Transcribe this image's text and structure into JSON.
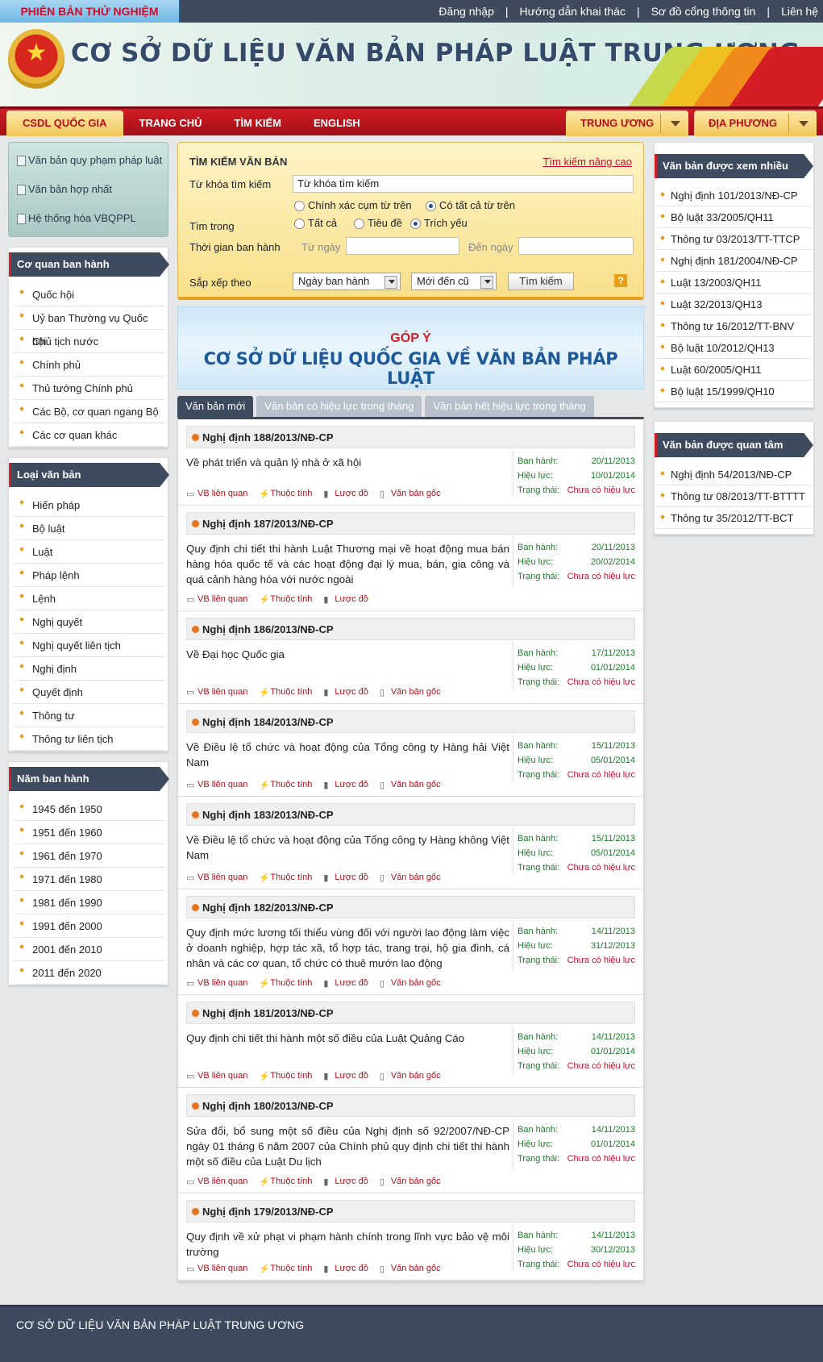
{
  "topbar": {
    "beta_label": "PHIÊN BẢN THỬ NGHIỆM",
    "links": [
      "Đăng nhập",
      "Hướng dẫn khai thác",
      "Sơ đồ cổng thông tin",
      "Liên hệ"
    ],
    "separator": "|"
  },
  "banner": {
    "title": "CƠ SỞ DỮ LIỆU VĂN BẢN PHÁP LUẬT TRUNG ƯƠNG"
  },
  "nav": {
    "left": [
      "CSDL QUỐC GIA",
      "TRANG CHỦ",
      "TÌM KIẾM",
      "ENGLISH"
    ],
    "right": [
      "TRUNG ƯƠNG",
      "ĐỊA PHƯƠNG"
    ]
  },
  "quick_links": [
    "Văn bản quy phạm pháp luật",
    "Văn bản hợp nhất",
    "Hệ thống hóa VBQPPL"
  ],
  "co_quan": {
    "title": "Cơ quan ban hành",
    "items": [
      "Quốc hội",
      "Uỷ ban Thường vụ Quốc hội",
      "Chủ tịch nước",
      "Chính phủ",
      "Thủ tướng Chính phủ",
      "Các Bộ, cơ quan ngang Bộ",
      "Các cơ quan khác"
    ]
  },
  "loai_vb": {
    "title": "Loại văn bản",
    "items": [
      "Hiến pháp",
      "Bộ luật",
      "Luật",
      "Pháp lệnh",
      "Lệnh",
      "Nghị quyết",
      "Nghị quyết liên tịch",
      "Nghị định",
      "Quyết định",
      "Thông tư",
      "Thông tư liên tịch"
    ]
  },
  "nam": {
    "title": "Năm ban hành",
    "items": [
      "1945 đến 1950",
      "1951 đến 1960",
      "1961 đến 1970",
      "1971 đến 1980",
      "1981 đến 1990",
      "1991 đến 2000",
      "2001 đến 2010",
      "2011 đến 2020"
    ]
  },
  "search": {
    "title": "TÌM KIẾM VĂN BẢN",
    "advanced": "Tìm kiếm nâng cao",
    "keyword_label": "Từ khóa tìm kiếm",
    "keyword_value": "Từ khóa tìm kiếm",
    "opt_exact": "Chính xác cụm từ trên",
    "opt_all_words": "Có tất cả từ trên",
    "search_in_label": "Tìm trong",
    "in_all": "Tất cả",
    "in_title": "Tiêu đề",
    "in_summary": "Trích yếu",
    "time_label": "Thời gian ban hành",
    "from_label": "Từ ngày",
    "to_label": "Đến ngày",
    "sort_label": "Sắp xếp theo",
    "sort_field": "Ngày ban hành",
    "sort_order": "Mới đến cũ",
    "button": "Tìm kiếm",
    "help": "?"
  },
  "gopy": {
    "line1": "GÓP Ý",
    "line2": "CƠ SỞ DỮ LIỆU QUỐC GIA VỀ VĂN BẢN PHÁP LUẬT"
  },
  "tabs": [
    "Văn bản mới",
    "Văn bản có hiệu lực trong tháng",
    "Văn bản hết hiệu lực trong tháng"
  ],
  "meta_labels": {
    "issued": "Ban hành:",
    "effective": "Hiệu lực:",
    "status": "Trạng thái:"
  },
  "actions": {
    "related": "VB liên quan",
    "props": "Thuộc tính",
    "summary": "Lược đồ",
    "original": "Văn bản gốc"
  },
  "docs": [
    {
      "title": "Nghị định 188/2013/NĐ-CP",
      "desc": "Về phát triển và quản lý nhà ở xã hội",
      "issued": "20/11/2013",
      "effective": "10/01/2014",
      "status": "Chưa có hiệu lực",
      "has_original": true,
      "h": 107
    },
    {
      "title": "Nghị định 187/2013/NĐ-CP",
      "desc": "Quy định chi tiết thi hành Luật Thương mại về hoạt động mua bán hàng hóa quốc tế và các hoạt động đại lý mua, bán, gia công và quá cảnh hàng hóa với nước ngoài",
      "issued": "20/11/2013",
      "effective": "20/02/2014",
      "status": "Chưa có hiệu lực",
      "has_original": false,
      "h": 131
    },
    {
      "title": "Nghị định 186/2013/NĐ-CP",
      "desc": "Về Đại học Quốc gia",
      "issued": "17/11/2013",
      "effective": "01/01/2014",
      "status": "Chưa có hiệu lực",
      "has_original": true,
      "h": 115
    },
    {
      "title": "Nghị định 184/2013/NĐ-CP",
      "desc": "Về Điều lệ tổ chức và hoạt động của Tổng công ty Hàng hải Việt Nam",
      "issued": "15/11/2013",
      "effective": "05/01/2014",
      "status": "Chưa có hiệu lực",
      "has_original": true,
      "h": 115
    },
    {
      "title": "Nghị định 183/2013/NĐ-CP",
      "desc": "Về Điều lệ tổ chức và hoạt động của Tổng công ty Hàng không Việt Nam",
      "issued": "15/11/2013",
      "effective": "05/01/2014",
      "status": "Chưa có hiệu lực",
      "has_original": true,
      "h": 115
    },
    {
      "title": "Nghị định 182/2013/NĐ-CP",
      "desc": "Quy định mức lương tối thiểu vùng đối với người lao động làm việc ở doanh nghiệp, hợp tác xã, tổ hợp tác, trang trại, hộ gia đình, cá nhân và các cơ quan, tổ chức có thuê mướn lao động",
      "issued": "14/11/2013",
      "effective": "31/12/2013",
      "status": "Chưa có hiệu lực",
      "has_original": true,
      "h": 131
    },
    {
      "title": "Nghị định 181/2013/NĐ-CP",
      "desc": "Quy định chi tiết thi hành một số điều của Luật Quảng Cáo",
      "issued": "14/11/2013",
      "effective": "01/01/2014",
      "status": "Chưa có hiệu lực",
      "has_original": true,
      "h": 115
    },
    {
      "title": "Nghị định 180/2013/NĐ-CP",
      "desc": "Sửa đổi, bổ sung một số điều của Nghị định số 92/2007/NĐ-CP ngày 01 tháng 6 năm 2007 của Chính phủ quy định chi tiết thi hành một số điều của Luật Du lịch",
      "issued": "14/11/2013",
      "effective": "01/01/2014",
      "status": "Chưa có hiệu lực",
      "has_original": true,
      "h": 131
    },
    {
      "title": "Nghị định 179/2013/NĐ-CP",
      "desc": "Quy định về xử phạt vi phạm hành chính trong lĩnh vực bảo vệ môi trường",
      "issued": "14/11/2013",
      "effective": "30/12/2013",
      "status": "Chưa có hiệu lực",
      "has_original": true,
      "h": 108
    }
  ],
  "xem_nhieu": {
    "title": "Văn bản được xem nhiều",
    "items": [
      "Nghị định 101/2013/NĐ-CP",
      "Bộ luật 33/2005/QH11",
      "Thông tư 03/2013/TT-TTCP",
      "Nghị định 181/2004/NĐ-CP",
      "Luật 13/2003/QH11",
      "Luật 32/2013/QH13",
      "Thông tư 16/2012/TT-BNV",
      "Bộ luật 10/2012/QH13",
      "Luật 60/2005/QH11",
      "Bộ luật 15/1999/QH10"
    ]
  },
  "quan_tam": {
    "title": "Văn bản được quan tâm",
    "items": [
      "Nghị định 54/2013/NĐ-CP",
      "Thông tư 08/2013/TT-BTTTT",
      "Thông tư 35/2012/TT-BCT"
    ]
  },
  "footer": {
    "text": "CƠ SỞ DỮ LIỆU VĂN BẢN PHÁP LUẬT TRUNG ƯƠNG"
  }
}
